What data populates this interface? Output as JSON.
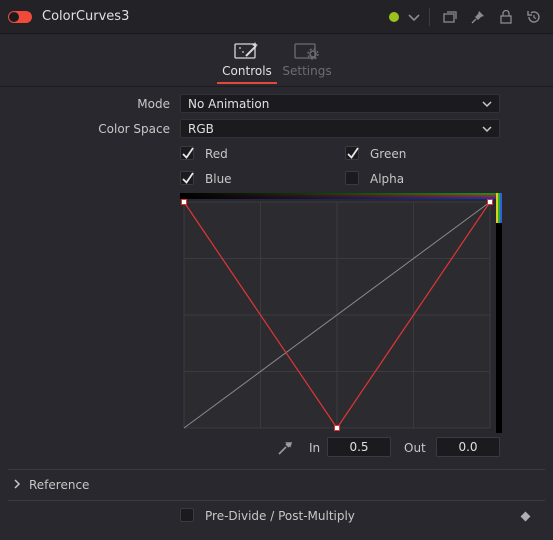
{
  "header": {
    "title": "ColorCurves3",
    "status_color": "#9cc21f",
    "icons": [
      "power-toggle-icon",
      "chevron-down-icon",
      "copy-icon",
      "pin-icon",
      "lock-icon",
      "reset-icon"
    ]
  },
  "tabs": [
    {
      "label": "Controls",
      "icon": "controls-wand-icon",
      "active": true
    },
    {
      "label": "Settings",
      "icon": "settings-gear-icon",
      "active": false
    }
  ],
  "controls": {
    "mode": {
      "label": "Mode",
      "value": "No Animation"
    },
    "color_space": {
      "label": "Color Space",
      "value": "RGB"
    },
    "channels": [
      {
        "label": "Red",
        "checked": true
      },
      {
        "label": "Green",
        "checked": true
      },
      {
        "label": "Blue",
        "checked": true
      },
      {
        "label": "Alpha",
        "checked": false
      }
    ]
  },
  "curve": {
    "points": [
      [
        0,
        1
      ],
      [
        0.5,
        0
      ],
      [
        1,
        1
      ]
    ],
    "line_color": "#e03535",
    "identity_color": "#8a8a8e"
  },
  "io": {
    "in_label": "In",
    "in_value": "0.5",
    "out_label": "Out",
    "out_value": "0.0"
  },
  "reference": {
    "label": "Reference"
  },
  "predivide": {
    "label": "Pre-Divide / Post-Multiply",
    "checked": false
  },
  "colors": {
    "accent": "#e04a3a",
    "background": "#28282e"
  }
}
